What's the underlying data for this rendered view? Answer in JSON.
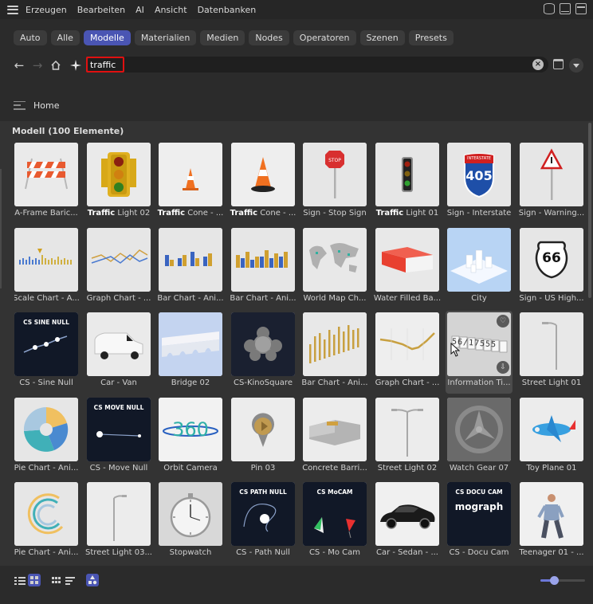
{
  "menu": {
    "items": [
      "Erzeugen",
      "Bearbeiten",
      "AI",
      "Ansicht",
      "Datenbanken"
    ]
  },
  "tabs": [
    {
      "label": "Auto",
      "active": false
    },
    {
      "label": "Alle",
      "active": false
    },
    {
      "label": "Modelle",
      "active": true
    },
    {
      "label": "Materialien",
      "active": false
    },
    {
      "label": "Medien",
      "active": false
    },
    {
      "label": "Nodes",
      "active": false
    },
    {
      "label": "Operatoren",
      "active": false
    },
    {
      "label": "Szenen",
      "active": false
    },
    {
      "label": "Presets",
      "active": false
    }
  ],
  "search": {
    "value": "traffic",
    "highlight_color": "#e01010"
  },
  "breadcrumb": {
    "label": "Home"
  },
  "section": {
    "title": "Modell (100 Elemente)"
  },
  "items": [
    {
      "label": "A-Frame Baric...",
      "icon": "barricade"
    },
    {
      "bold": "Traffic",
      "rest": " Light 02",
      "icon": "traffic-light"
    },
    {
      "bold": "Traffic",
      "rest": " Cone - ...",
      "icon": "cone"
    },
    {
      "bold": "Traffic",
      "rest": " Cone - ...",
      "icon": "cone-dark"
    },
    {
      "label": "Sign - Stop Sign",
      "icon": "stop-sign"
    },
    {
      "bold": "Traffic",
      "rest": " Light 01",
      "icon": "traffic-light-small"
    },
    {
      "label": "Sign - Interstate",
      "icon": "interstate-sign",
      "sign_text": "405",
      "sign_head": "INTERSTATE"
    },
    {
      "label": "Sign - Warning...",
      "icon": "warning-sign"
    },
    {
      "label": "Scale Chart - A...",
      "icon": "scale-chart"
    },
    {
      "label": "Graph Chart - ...",
      "icon": "graph-chart"
    },
    {
      "label": "Bar Chart - Ani...",
      "icon": "bar-chart-color"
    },
    {
      "label": "Bar Chart - Ani...",
      "icon": "bar-chart-gold"
    },
    {
      "label": "World Map Ch...",
      "icon": "world-map"
    },
    {
      "label": "Water Filled Ba...",
      "icon": "water-barrier"
    },
    {
      "label": "City",
      "icon": "city"
    },
    {
      "label": "Sign - US High...",
      "icon": "us-highway-sign",
      "sign_text": "66"
    },
    {
      "label": "CS - Sine Null",
      "icon": "sine-null",
      "card_title": "CS SINE NULL"
    },
    {
      "label": "Car - Van",
      "icon": "van"
    },
    {
      "label": "Bridge 02",
      "icon": "bridge"
    },
    {
      "label": "CS-KinoSquare",
      "icon": "kino-square"
    },
    {
      "label": "Bar Chart - Ani...",
      "icon": "bar-chart-bars"
    },
    {
      "label": "Graph Chart - ...",
      "icon": "graph-chart-gold"
    },
    {
      "label": "Information Ti...",
      "icon": "info-ticker",
      "hover": true,
      "ticker_text": "56/17555"
    },
    {
      "label": "Street Light 01",
      "icon": "street-light"
    },
    {
      "label": "Pie Chart - Ani...",
      "icon": "pie-chart"
    },
    {
      "label": "CS - Move Null",
      "icon": "move-null",
      "card_title": "CS MOVE NULL"
    },
    {
      "label": "Orbit Camera",
      "icon": "orbit-camera",
      "card_title": "360"
    },
    {
      "label": "Pin 03",
      "icon": "pin"
    },
    {
      "label": "Concrete Barri...",
      "icon": "concrete-barrier"
    },
    {
      "label": "Street Light 02",
      "icon": "street-light-double"
    },
    {
      "label": "Watch Gear 07",
      "icon": "watch-gear"
    },
    {
      "label": "Toy Plane 01",
      "icon": "toy-plane"
    },
    {
      "label": "Pie Chart - Ani...",
      "icon": "ring-chart"
    },
    {
      "label": "Street Light 03...",
      "icon": "street-light-3"
    },
    {
      "label": "Stopwatch",
      "icon": "stopwatch"
    },
    {
      "label": "CS - Path Null",
      "icon": "path-null",
      "card_title": "CS PATH NULL"
    },
    {
      "label": "CS - Mo Cam",
      "icon": "mo-cam",
      "card_title": "CS MoCAM"
    },
    {
      "label": "Car - Sedan - ...",
      "icon": "sedan"
    },
    {
      "label": "CS - Docu Cam",
      "icon": "docu-cam",
      "card_title": "CS DOCU CAM",
      "card_sub": "mograph"
    },
    {
      "label": "Teenager 01 - ...",
      "icon": "teenager"
    }
  ],
  "colors": {
    "accent": "#4a55b3",
    "slider": "#6c78d8"
  },
  "zoom": {
    "fraction": 0.3
  }
}
